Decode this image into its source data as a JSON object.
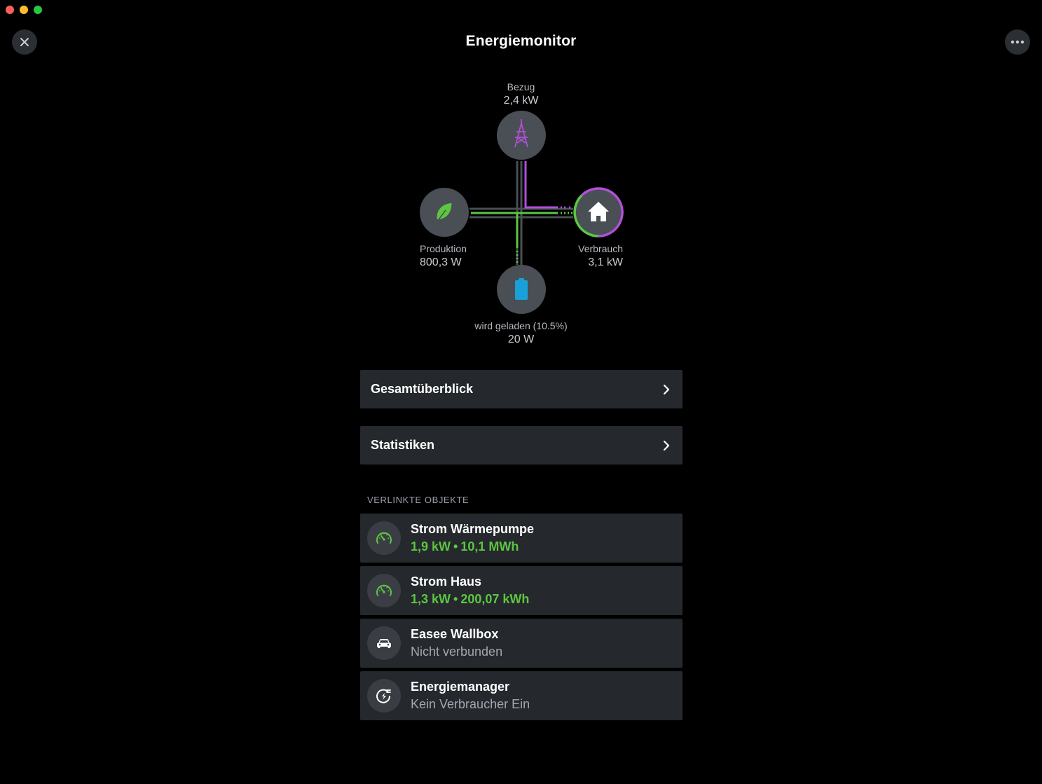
{
  "window": {
    "title": "Energiemonitor"
  },
  "flow": {
    "grid": {
      "label": "Bezug",
      "value": "2,4 kW"
    },
    "production": {
      "label": "Produktion",
      "value": "800,3 W"
    },
    "consumption": {
      "label": "Verbrauch",
      "value": "3,1 kW"
    },
    "battery": {
      "label": "wird geladen (10.5%)",
      "value": "20 W",
      "charge_fraction": 0.105
    },
    "colors": {
      "grid": "#b050d8",
      "solar": "#5cc642",
      "battery": "#1aa0d8",
      "idle": "#4a4e55"
    }
  },
  "nav": {
    "overview": "Gesamtüberblick",
    "statistics": "Statistiken"
  },
  "linked": {
    "header": "VERLINKTE OBJEKTE",
    "items": [
      {
        "name": "Strom Wärmepumpe",
        "power": "1,9 kW",
        "energy": "10,1 MWh",
        "icon": "meter-icon"
      },
      {
        "name": "Strom Haus",
        "power": "1,3 kW",
        "energy": "200,07 kWh",
        "icon": "meter-icon"
      },
      {
        "name": "Easee Wallbox",
        "status": "Nicht verbunden",
        "icon": "car-icon"
      },
      {
        "name": "Energiemanager",
        "status": "Kein Verbraucher Ein",
        "icon": "energy-manager-icon"
      }
    ]
  }
}
